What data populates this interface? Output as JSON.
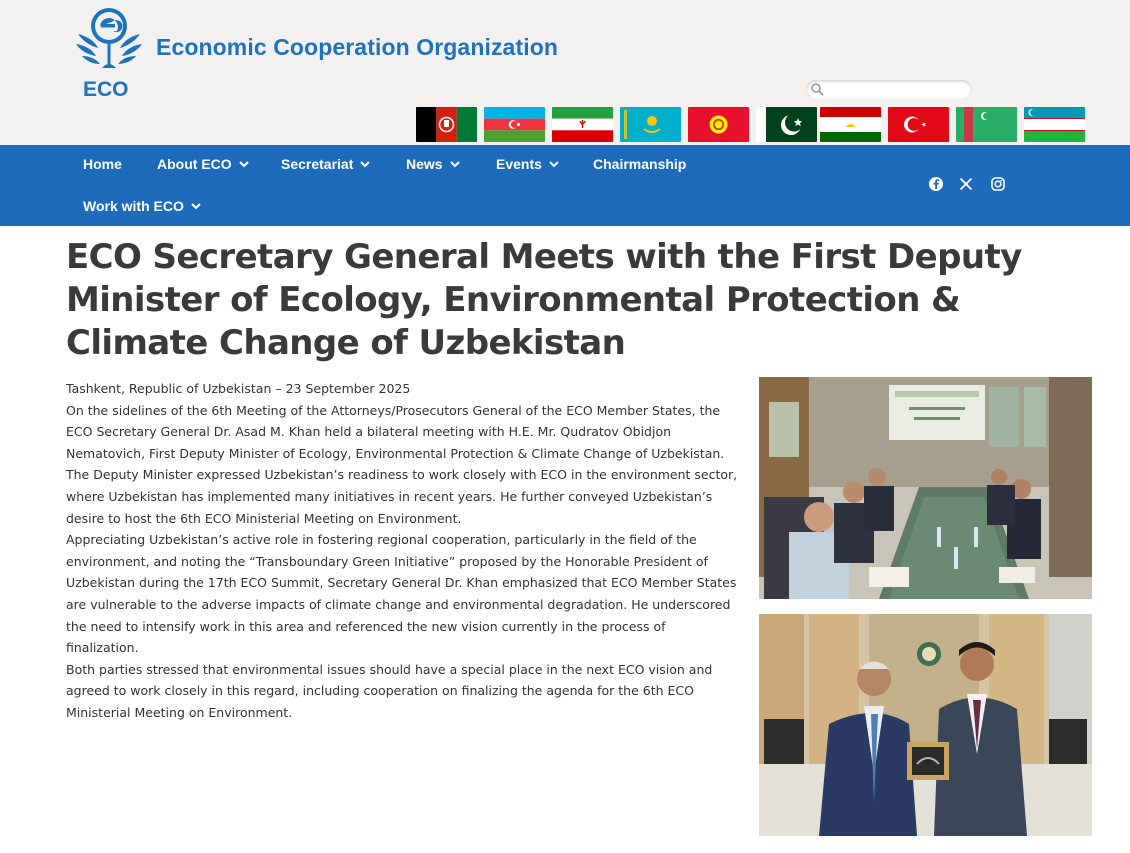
{
  "header": {
    "logo_text": "ECO",
    "org_name": "Economic Cooperation Organization",
    "search": {
      "placeholder": "",
      "value": ""
    }
  },
  "flags": [
    {
      "country": "Afghanistan",
      "icon": "flag-afghanistan"
    },
    {
      "country": "Azerbaijan",
      "icon": "flag-azerbaijan"
    },
    {
      "country": "Iran",
      "icon": "flag-iran"
    },
    {
      "country": "Kazakhstan",
      "icon": "flag-kazakhstan"
    },
    {
      "country": "Kyrgyzstan",
      "icon": "flag-kyrgyzstan"
    },
    {
      "country": "Pakistan",
      "icon": "flag-pakistan"
    },
    {
      "country": "Tajikistan",
      "icon": "flag-tajikistan"
    },
    {
      "country": "Turkiye",
      "icon": "flag-turkiye"
    },
    {
      "country": "Turkmenistan",
      "icon": "flag-turkmenistan"
    },
    {
      "country": "Uzbekistan",
      "icon": "flag-uzbekistan"
    }
  ],
  "nav": {
    "items": [
      {
        "label": "Home",
        "dropdown": false
      },
      {
        "label": "About ECO",
        "dropdown": true
      },
      {
        "label": "Secretariat",
        "dropdown": true
      },
      {
        "label": "News",
        "dropdown": true
      },
      {
        "label": "Events",
        "dropdown": true
      },
      {
        "label": "Chairmanship",
        "dropdown": false
      },
      {
        "label": "Work with ECO",
        "dropdown": true
      }
    ],
    "social": [
      "facebook-icon",
      "x-icon",
      "instagram-icon"
    ]
  },
  "article": {
    "title": "ECO Secretary General Meets with the First Deputy Minister of Ecology, Environmental Protection & Climate Change of Uzbekistan",
    "paragraphs": [
      "Tashkent, Republic of Uzbekistan – 23 September 2025",
      "On the sidelines of the 6th Meeting of the Attorneys/Prosecutors General of the ECO Member States, the ECO Secretary General Dr. Asad M. Khan held a bilateral meeting with H.E. Mr. Qudratov Obidjon Nematovich, First Deputy Minister of Ecology, Environmental Protection & Climate Change of Uzbekistan.",
      "The Deputy Minister expressed Uzbekistan’s readiness to work closely with ECO in the environment sector, where Uzbekistan has implemented many initiatives in recent years. He further conveyed Uzbekistan’s desire to host the 6th ECO Ministerial Meeting on Environment.",
      "Appreciating Uzbekistan’s active role in fostering regional cooperation, particularly in the field of the environment, and noting the “Transboundary Green Initiative” proposed by the Honorable President of Uzbekistan during the 17th ECO Summit, Secretary General Dr. Khan emphasized that ECO Member States are vulnerable to the adverse impacts of climate change and environmental degradation. He underscored the need to intensify work in this area and referenced the new vision currently in the process of finalization.",
      "Both parties stressed that environmental issues should have a special place in the next ECO vision and agreed to work closely in this regard, including cooperation on finalizing the agenda for the 6th ECO Ministerial Meeting on Environment."
    ],
    "photos": [
      {
        "name": "meeting-photo"
      },
      {
        "name": "handshake-photo"
      }
    ]
  },
  "colors": {
    "brand_blue": "#1f73bb",
    "nav_blue": "#1e6bbc",
    "header_bg": "#f2f1f0"
  }
}
